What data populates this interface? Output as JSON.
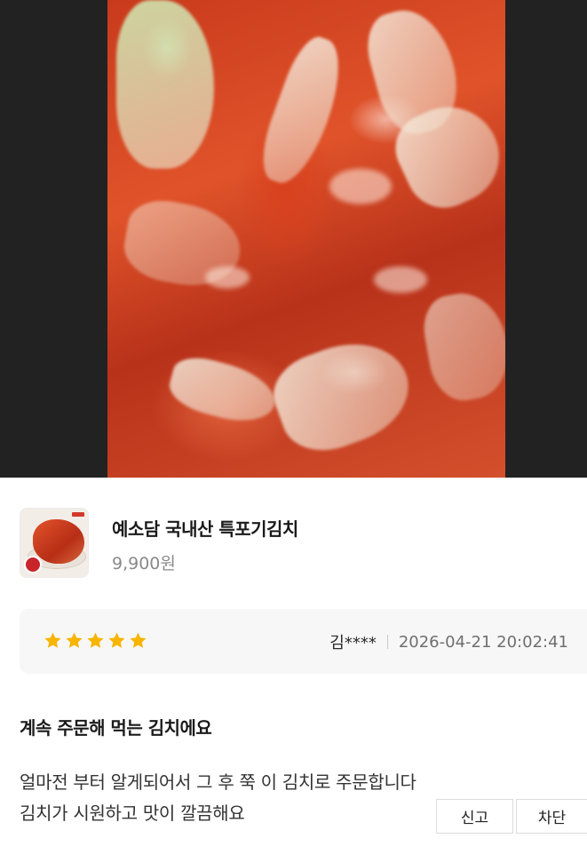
{
  "product": {
    "name": "예소담 국내산 특포기김치",
    "price": "9,900원"
  },
  "review": {
    "rating": 5,
    "rating_max": 5,
    "author": "김****",
    "date": "2026-04-21 20:02:41",
    "title": "계속 주문해 먹는 김치에요",
    "body_line1": "얼마전 부터 알게되어서 그 후 쭉 이 김치로 주문합니다",
    "body_line2": "김치가 시원하고 맛이 깔끔해요"
  },
  "actions": {
    "report_label": "신고",
    "block_label": "차단"
  },
  "colors": {
    "star": "#f7b500",
    "card_bg": "#f7f7f8",
    "photo_backdrop": "#222222"
  }
}
